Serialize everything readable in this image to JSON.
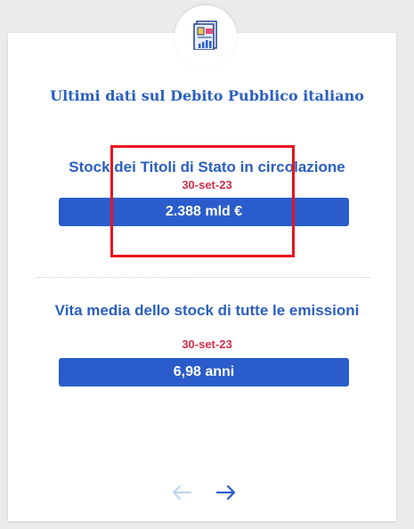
{
  "header": {
    "icon": "report-chart-icon",
    "title": "Ultimi dati sul Debito Pubblico italiano"
  },
  "sections": [
    {
      "title": "Stock dei Titoli di Stato in circolazione",
      "date": "30-set-23",
      "value": "2.388 mld €"
    },
    {
      "title": "Vita media dello stock di tutte le emissioni",
      "date": "30-set-23",
      "value": "6,98 anni"
    }
  ],
  "navigation": {
    "prev_icon": "arrow-left-icon",
    "next_icon": "arrow-right-icon",
    "prev_enabled": false,
    "next_enabled": true
  },
  "colors": {
    "accent_blue": "#2a5dcb",
    "title_blue": "#2a5fc0",
    "date_red": "#d32f4a",
    "highlight_red": "#e8141f"
  }
}
